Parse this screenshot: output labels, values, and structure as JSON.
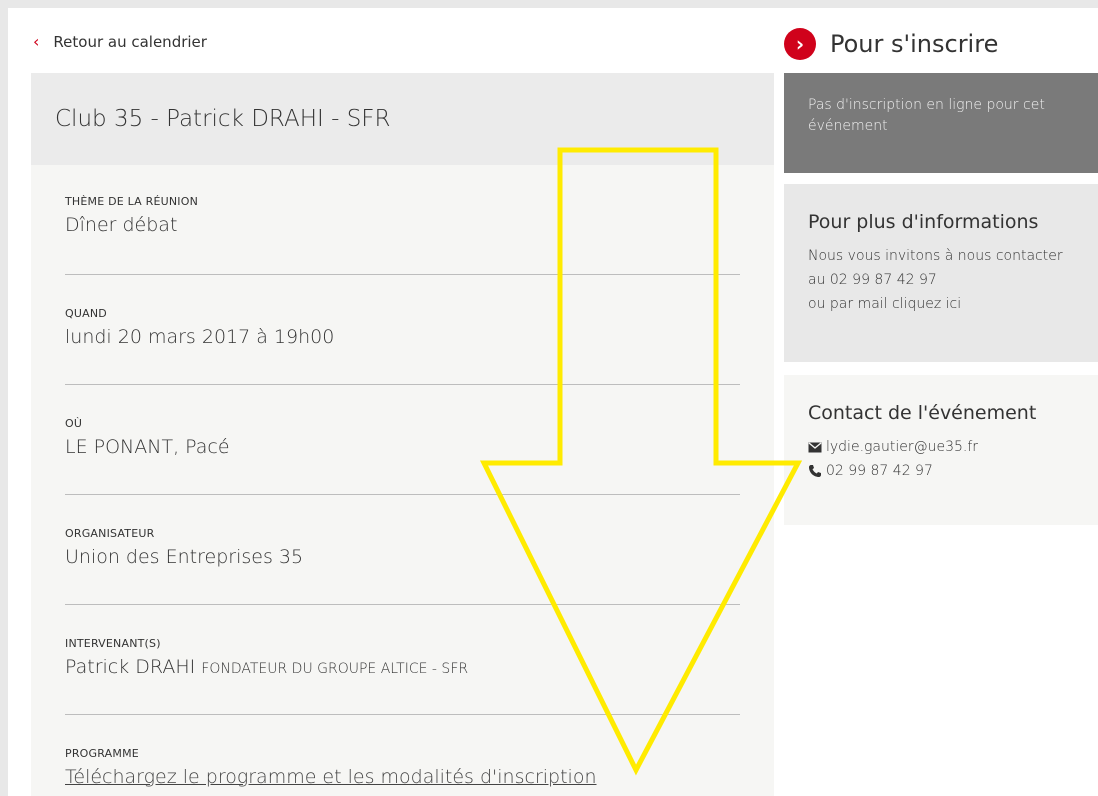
{
  "back": {
    "label": "Retour au calendrier"
  },
  "event": {
    "title": "Club 35 - Patrick DRAHI - SFR",
    "fields": [
      {
        "label": "THÈME DE LA RÉUNION",
        "value": "Dîner débat"
      },
      {
        "label": "QUAND",
        "value": "lundi 20 mars 2017 à 19h00"
      },
      {
        "label": "OÙ",
        "value": "LE PONANT, Pacé"
      },
      {
        "label": "ORGANISATEUR",
        "value": "Union des Entreprises 35"
      },
      {
        "label": "INTERVENANT(S)",
        "value": "Patrick DRAHI",
        "role": "FONDATEUR DU GROUPE ALTICE - SFR"
      },
      {
        "label": "PROGRAMME",
        "value": "Téléchargez le programme et les modalités d'inscription"
      }
    ]
  },
  "sidebar": {
    "register_title": "Pour s'inscrire",
    "no_online_registration": "Pas d'inscription en ligne pour cet événement",
    "info": {
      "title": "Pour plus d'informations",
      "line1": "Nous vous invitons à nous contacter",
      "line2": "au 02 99 87 42 97",
      "line3": "ou par mail cliquez ici"
    },
    "contact": {
      "title": "Contact de l'événement",
      "email": "lydie.gautier@ue35.fr",
      "phone": "02 99 87 42 97"
    }
  },
  "colors": {
    "accent": "#d0021b",
    "highlight_arrow": "#ffeb00"
  },
  "icons": {
    "back": "chevron-left-icon",
    "register": "chevron-right-circle-icon",
    "email": "envelope-icon",
    "phone": "phone-icon"
  }
}
